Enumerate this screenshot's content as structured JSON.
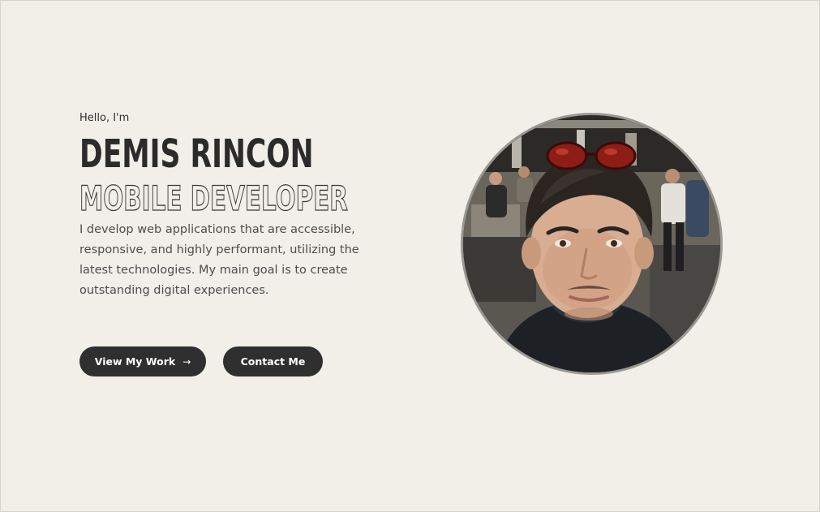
{
  "hero": {
    "greeting": "Hello, I'm",
    "name": "DEMIS RINCON",
    "role": "MOBILE DEVELOPER",
    "bio": "I develop web applications that are accessible, responsive, and highly performant, utilizing the latest technologies. My main goal is to create outstanding digital experiences."
  },
  "actions": {
    "view_work_label": "View My Work",
    "view_work_icon": "arrow-right-icon",
    "contact_label": "Contact Me"
  },
  "colors": {
    "background": "#f1efe8",
    "text_dark": "#2b2b2b",
    "button_bg": "#2f2f2f",
    "button_text": "#ffffff",
    "avatar_border": "#9a9893"
  }
}
